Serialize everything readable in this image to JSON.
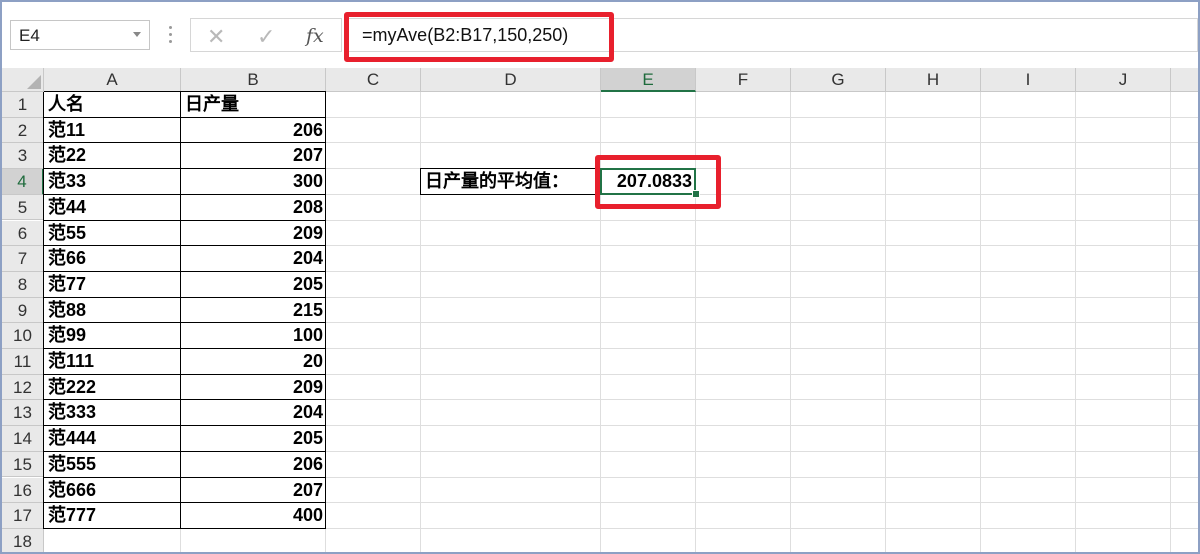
{
  "name_box": {
    "value": "E4"
  },
  "formula_bar": {
    "cancel_icon": "✕",
    "enter_icon": "✓",
    "fx_label": "fx",
    "formula": "=myAve(B2:B17,150,250)"
  },
  "columns": [
    "A",
    "B",
    "C",
    "D",
    "E",
    "F",
    "G",
    "H",
    "I",
    "J"
  ],
  "selected_column": "E",
  "selected_row": 4,
  "rows": [
    "1",
    "2",
    "3",
    "4",
    "5",
    "6",
    "7",
    "8",
    "9",
    "10",
    "11",
    "12",
    "13",
    "14",
    "15",
    "16",
    "17",
    "18"
  ],
  "table": {
    "header": {
      "name": "人名",
      "value": "日产量"
    },
    "rows": [
      {
        "name": "范11",
        "value": "206"
      },
      {
        "name": "范22",
        "value": "207"
      },
      {
        "name": "范33",
        "value": "300"
      },
      {
        "name": "范44",
        "value": "208"
      },
      {
        "name": "范55",
        "value": "209"
      },
      {
        "name": "范66",
        "value": "204"
      },
      {
        "name": "范77",
        "value": "205"
      },
      {
        "name": "范88",
        "value": "215"
      },
      {
        "name": "范99",
        "value": "100"
      },
      {
        "name": "范111",
        "value": "20"
      },
      {
        "name": "范222",
        "value": "209"
      },
      {
        "name": "范333",
        "value": "204"
      },
      {
        "name": "范444",
        "value": "205"
      },
      {
        "name": "范555",
        "value": "206"
      },
      {
        "name": "范666",
        "value": "207"
      },
      {
        "name": "范777",
        "value": "400"
      }
    ]
  },
  "result": {
    "label": "日产量的平均值：",
    "value": "207.0833"
  },
  "colors": {
    "highlight": "#e8202d",
    "selection": "#217346"
  }
}
